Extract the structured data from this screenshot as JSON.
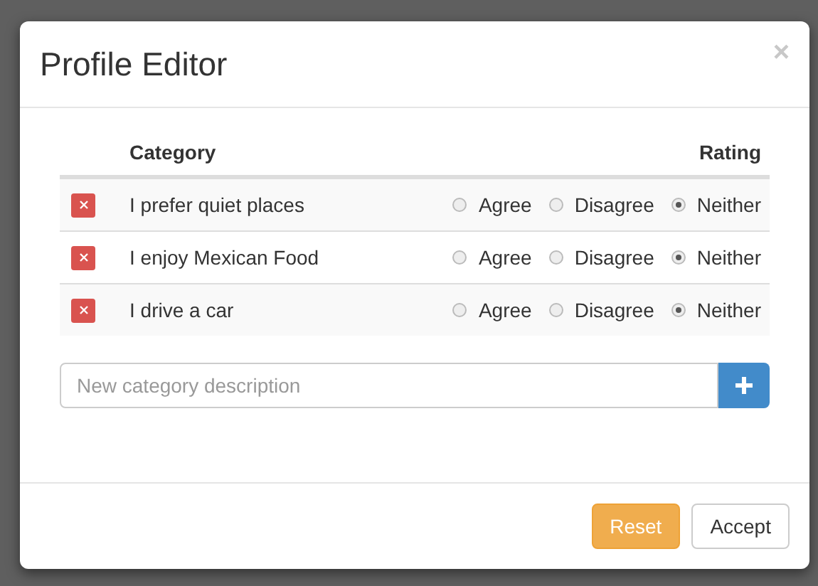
{
  "dialog": {
    "title": "Profile Editor",
    "close": "×"
  },
  "table": {
    "columns": [
      "Category",
      "Rating"
    ],
    "rows": [
      {
        "category": "I prefer quiet places",
        "options": [
          {
            "label": "Agree",
            "selected": false
          },
          {
            "label": "Disagree",
            "selected": false
          },
          {
            "label": "Neither",
            "selected": true
          }
        ]
      },
      {
        "category": "I enjoy Mexican Food",
        "options": [
          {
            "label": "Agree",
            "selected": false
          },
          {
            "label": "Disagree",
            "selected": false
          },
          {
            "label": "Neither",
            "selected": true
          }
        ]
      },
      {
        "category": "I drive a car",
        "options": [
          {
            "label": "Agree",
            "selected": false
          },
          {
            "label": "Disagree",
            "selected": false
          },
          {
            "label": "Neither",
            "selected": true
          }
        ]
      }
    ]
  },
  "new_category": {
    "placeholder": "New category description"
  },
  "buttons": [
    {
      "label": "Reset",
      "kind": "warning"
    },
    {
      "label": "Accept",
      "kind": "default"
    }
  ]
}
